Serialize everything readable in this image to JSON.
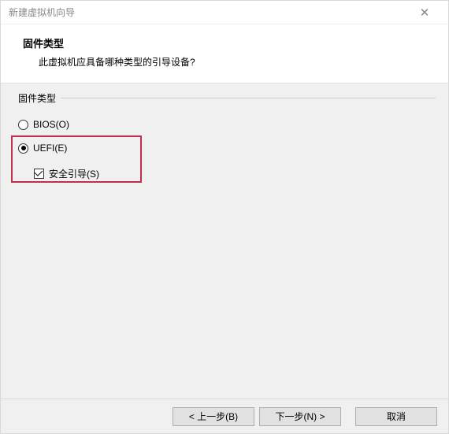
{
  "window": {
    "title": "新建虚拟机向导",
    "close_glyph": "✕"
  },
  "header": {
    "heading": "固件类型",
    "subheading": "此虚拟机应具备哪种类型的引导设备?"
  },
  "group": {
    "label": "固件类型",
    "options": {
      "bios": {
        "label": "BIOS(O)",
        "selected": false
      },
      "uefi": {
        "label": "UEFI(E)",
        "selected": true,
        "secure_boot": {
          "label": "安全引导(S)",
          "checked": true
        }
      }
    }
  },
  "footer": {
    "back": "< 上一步(B)",
    "next": "下一步(N) >",
    "cancel": "取消"
  }
}
